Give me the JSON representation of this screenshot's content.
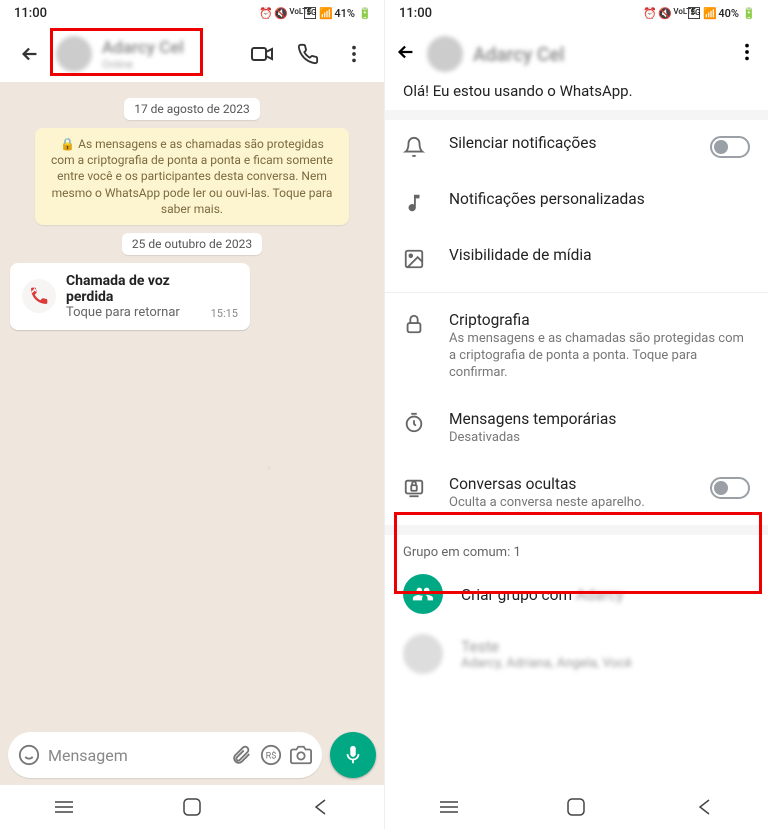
{
  "left": {
    "statusbar": {
      "time": "11:00",
      "battery": "41%"
    },
    "contact_name": "Adarcy Cel",
    "contact_status": "Online",
    "date1": "17 de agosto de 2023",
    "encryption_notice": "🔒 As mensagens e as chamadas são protegidas com a criptografia de ponta a ponta e ficam somente entre você e os participantes desta conversa. Nem mesmo o WhatsApp pode ler ou ouvi-las. Toque para saber mais.",
    "date2": "25 de outubro de 2023",
    "missed_call": {
      "title": "Chamada de voz perdida",
      "subtitle": "Toque para retornar",
      "time": "15:15"
    },
    "input_placeholder": "Mensagem"
  },
  "right": {
    "statusbar": {
      "time": "11:00",
      "battery": "40%"
    },
    "contact_name": "Adarcy Cel",
    "about": "Olá! Eu estou usando o WhatsApp.",
    "mute": {
      "title": "Silenciar notificações"
    },
    "custom_notif": {
      "title": "Notificações personalizadas"
    },
    "media_vis": {
      "title": "Visibilidade de mídia"
    },
    "encryption": {
      "title": "Criptografia",
      "desc": "As mensagens e as chamadas são protegidas com a criptografia de ponta a ponta. Toque para confirmar."
    },
    "disappearing": {
      "title": "Mensagens temporárias",
      "desc": "Desativadas"
    },
    "chatlock": {
      "title": "Conversas ocultas",
      "desc": "Oculta a conversa neste aparelho."
    },
    "groups_header": "Grupo em comum: 1",
    "create_group_prefix": "Criar grupo com ",
    "create_group_name": "Adarcy",
    "group_item": {
      "title": "Teste",
      "subtitle": "Adarcy, Adriana, Angela, Você"
    }
  }
}
